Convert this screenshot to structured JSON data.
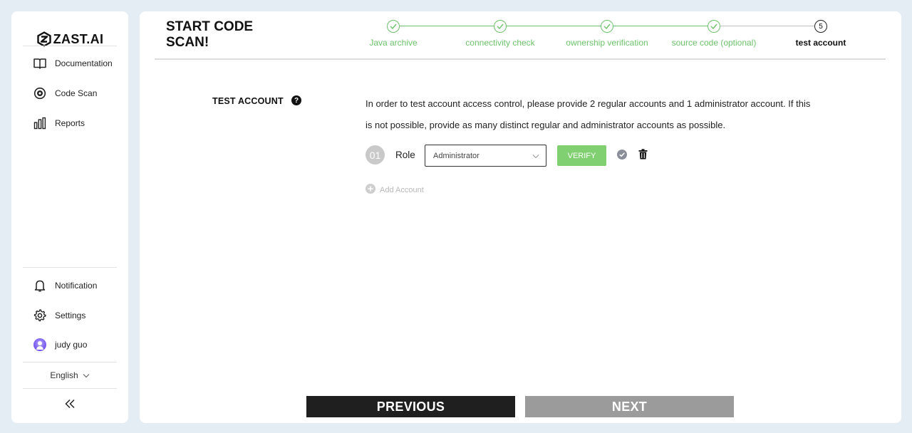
{
  "app": {
    "brand": "ZAST.AI",
    "logo_icon": "zast-logo-icon"
  },
  "sidebar": {
    "nav": [
      {
        "label": "Documentation",
        "icon": "book-icon"
      },
      {
        "label": "Code Scan",
        "icon": "scan-target-icon"
      },
      {
        "label": "Reports",
        "icon": "bar-chart-icon"
      }
    ],
    "bottom": [
      {
        "label": "Notification",
        "icon": "bell-icon"
      },
      {
        "label": "Settings",
        "icon": "gear-icon"
      },
      {
        "label": "judy guo",
        "icon": "avatar"
      }
    ],
    "language": "English",
    "collapse_icon": "double-chevron-left-icon"
  },
  "main": {
    "title": "START CODE SCAN!",
    "steps": [
      {
        "label": "Java archive",
        "status": "done"
      },
      {
        "label": "connectivity check",
        "status": "done"
      },
      {
        "label": "ownership verification",
        "status": "done"
      },
      {
        "label": "source code (optional)",
        "status": "done"
      },
      {
        "label": "test account",
        "status": "current",
        "number": "5"
      }
    ],
    "section": {
      "title": "TEST ACCOUNT",
      "help_icon": "question-circle-icon",
      "description": "In order to test account access control, please provide 2 regular accounts and 1 administrator account. If this is not possible, provide as many distinct regular and administrator accounts as possible."
    },
    "accounts": [
      {
        "number": "01",
        "role_label": "Role",
        "role_value": "Administrator",
        "verify_label": "VERIFY"
      }
    ],
    "add_account_label": "Add Account",
    "buttons": {
      "previous": "PREVIOUS",
      "next": "NEXT"
    }
  },
  "colors": {
    "background": "#e4ecf4",
    "accent_green": "#6cc26a",
    "verify_green": "#80cf71",
    "primary_dark": "#1f1f1f",
    "disabled_gray": "#9b9b9b"
  }
}
